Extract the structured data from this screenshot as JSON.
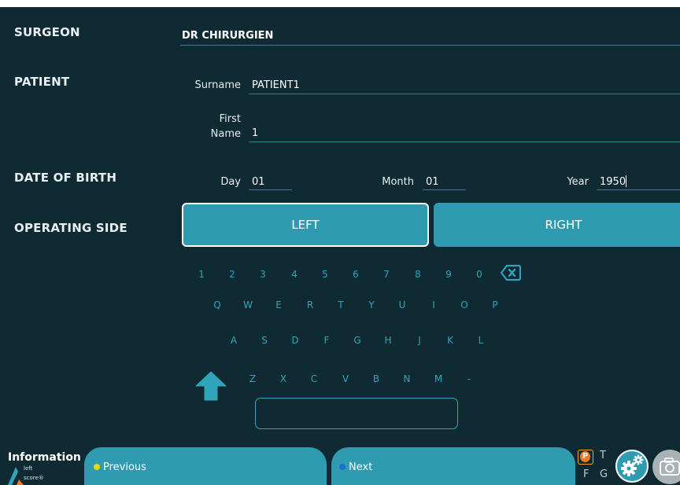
{
  "sections": {
    "surgeon": "SURGEON",
    "patient": "PATIENT",
    "date_of_birth": "DATE OF BIRTH",
    "operating_side": "OPERATING SIDE"
  },
  "surgeon": {
    "value": "DR CHIRURGIEN"
  },
  "patient": {
    "surname_label": "Surname",
    "surname_value": "PATIENT1",
    "first_label_line1": "First",
    "first_label_line2": "Name",
    "first_value": "1"
  },
  "dob": {
    "day_label": "Day",
    "day_value": "01",
    "month_label": "Month",
    "month_value": "01",
    "year_label": "Year",
    "year_value": "1950"
  },
  "side": {
    "left": "LEFT",
    "right": "RIGHT",
    "selected": "LEFT"
  },
  "keyboard": {
    "row1": [
      "1",
      "2",
      "3",
      "4",
      "5",
      "6",
      "7",
      "8",
      "9",
      "0"
    ],
    "row2": [
      "Q",
      "W",
      "E",
      "R",
      "T",
      "Y",
      "U",
      "I",
      "O",
      "P"
    ],
    "row3": [
      "A",
      "S",
      "D",
      "F",
      "G",
      "H",
      "J",
      "K",
      "L"
    ],
    "row4": [
      "Z",
      "X",
      "C",
      "V",
      "B",
      "N",
      "M",
      "-"
    ],
    "backspace_icon": "backspace-icon",
    "shift_icon": "shift-arrow-icon",
    "input_value": ""
  },
  "footer": {
    "title": "Information",
    "logo_line1": "left",
    "logo_line2": "score®",
    "previous": "Previous",
    "next": "Next",
    "badge": "P",
    "letter_t": "T",
    "letter_f": "F",
    "letter_g": "G",
    "settings_icon": "gears-icon",
    "camera_icon": "camera-icon"
  },
  "colors": {
    "background": "#102a33",
    "accent": "#2f9bb0",
    "key_text": "#2fa4ba",
    "previous_dot": "#f5d20a",
    "next_dot": "#1e6fd0",
    "badge": "#f07a1e"
  }
}
